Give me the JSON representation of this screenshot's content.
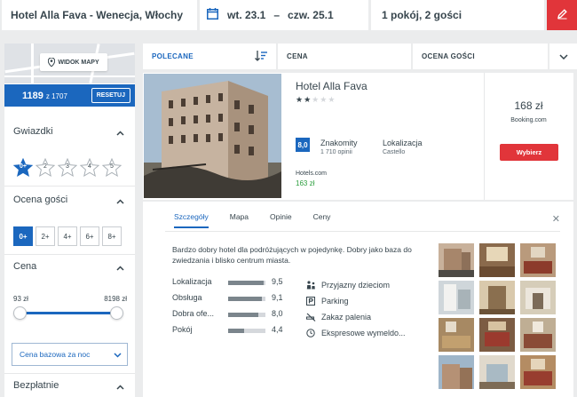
{
  "search": {
    "destination": "Hotel Alla Fava - Wenecja, Włochy",
    "checkin": "wt. 23.1",
    "separator": "–",
    "checkout": "czw. 25.1",
    "guests": "1 pokój, 2 gości"
  },
  "sidebar": {
    "map_button": "WIDOK MAPY",
    "price_value": "1189",
    "price_count": "z 1707",
    "reset_label": "RESETUJ",
    "stars_title": "Gwiazdki",
    "stars": [
      "0+",
      "2",
      "3",
      "4",
      "5"
    ],
    "stars_selected": "0+",
    "rating_title": "Ocena gości",
    "rating_options": [
      "0+",
      "2+",
      "4+",
      "6+",
      "8+"
    ],
    "rating_selected": "0+",
    "price_title": "Cena",
    "price_min": "93 zł",
    "price_max": "8198 zł",
    "price_basis": "Cena bazowa za noc",
    "free_title": "Bezpłatnie"
  },
  "sort": {
    "recommended": "POLECANE",
    "price": "CENA",
    "rating": "OCENA GOŚCI"
  },
  "hotel": {
    "name": "Hotel Alla Fava",
    "stars": 2,
    "score": "8,0",
    "score_label": "Znakomity",
    "reviews": "1 710 opinii",
    "location_label": "Lokalizacja",
    "location_value": "Castello",
    "provider": "Hotels.com",
    "provider_price": "163 zł",
    "deal_price": "168 zł",
    "deal_site": "Booking.com",
    "deal_button": "Wybierz"
  },
  "details": {
    "tabs": [
      "Szczegóły",
      "Mapa",
      "Opinie",
      "Ceny"
    ],
    "active_tab": "Szczegóły",
    "description": "Bardzo dobry hotel dla podróżujących w pojedynkę. Dobry jako baza do zwiedzania i blisko centrum miasta.",
    "ratings": [
      {
        "label": "Lokalizacja",
        "value": "9,5",
        "fraction": 0.95
      },
      {
        "label": "Obsługa",
        "value": "9,1",
        "fraction": 0.91
      },
      {
        "label": "Dobra ofe...",
        "value": "8,0",
        "fraction": 0.8
      },
      {
        "label": "Pokój",
        "value": "4,4",
        "fraction": 0.44
      }
    ],
    "amenities": [
      {
        "label": "Przyjazny dzieciom",
        "icon": "family-icon"
      },
      {
        "label": "Parking",
        "icon": "parking-icon"
      },
      {
        "label": "Zakaz palenia",
        "icon": "no-smoking-icon"
      },
      {
        "label": "Ekspresowe wymeldo...",
        "icon": "clock-icon"
      }
    ]
  },
  "colors": {
    "accent_blue": "#1b67be",
    "cta_red": "#e1353a",
    "provider_green": "#2a9d3c"
  }
}
